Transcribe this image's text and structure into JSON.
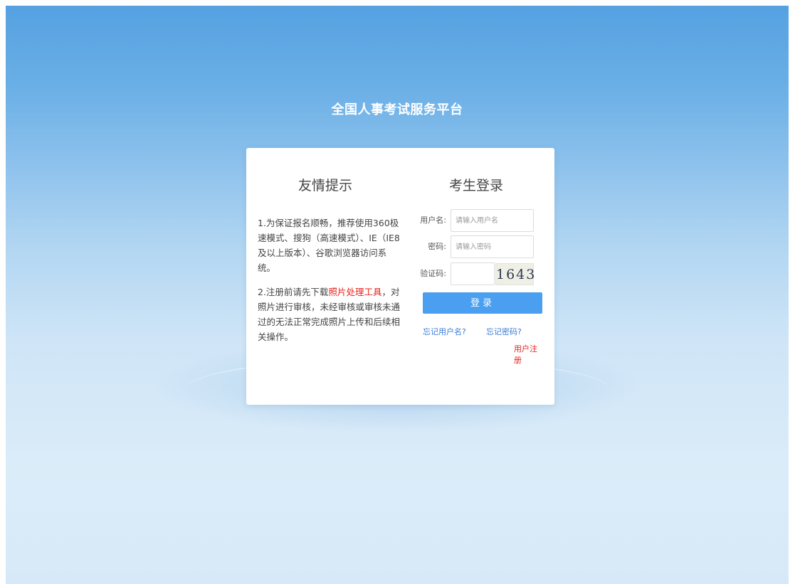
{
  "site_title": "全国人事考试服务平台",
  "tips": {
    "title": "友情提示",
    "tip1": "1.为保证报名顺畅，推荐使用360极速模式、搜狗（高速模式）、IE（IE8及以上版本）、谷歌浏览器访问系统。",
    "tip2_before": "2.注册前请先下载",
    "tip2_link": "照片处理工具",
    "tip2_after": "，对照片进行审核，未经审核或审核未通过的无法正常完成照片上传和后续相关操作。"
  },
  "login": {
    "title": "考生登录",
    "username_label": "用户名:",
    "username_placeholder": "请输入用户名",
    "password_label": "密码:",
    "password_placeholder": "请输入密码",
    "captcha_label": "验证码:",
    "captcha_value": "1643",
    "submit_label": "登录",
    "forgot_username": "忘记用户名?",
    "forgot_password": "忘记密码?",
    "register": "用户注册"
  }
}
